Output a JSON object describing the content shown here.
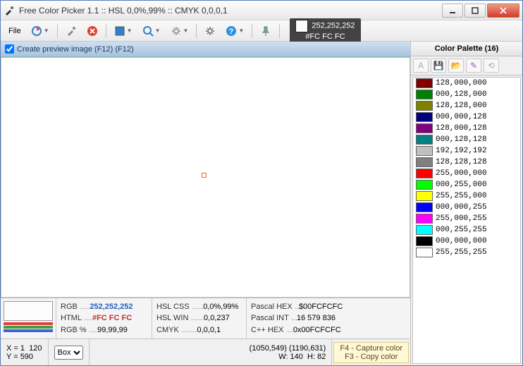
{
  "title": "Free Color Picker 1.1  ::  HSL 0,0%,99%  ::  CMYK 0,0,0,1",
  "file_menu": "File",
  "color_display": {
    "rgb": "252,252,252",
    "hex": "#FC  FC  FC"
  },
  "preview_label": "Create preview image (F12) (F12)",
  "info": {
    "rgb": {
      "label": "RGB",
      "value": "252,252,252"
    },
    "html": {
      "label": "HTML",
      "value": "#FC  FC  FC"
    },
    "rgbp": {
      "label": "RGB %",
      "value": "99,99,99"
    },
    "hslcss": {
      "label": "HSL CSS",
      "value": "0,0%,99%"
    },
    "hslwin": {
      "label": "HSL WIN",
      "value": "0,0,237"
    },
    "cmyk": {
      "label": "CMYK",
      "value": "0,0,0,1"
    },
    "pascalhex": {
      "label": "Pascal HEX",
      "value": "$00FCFCFC"
    },
    "pascalint": {
      "label": "Pascal INT",
      "value": "16 579 836"
    },
    "cpphex": {
      "label": "C++ HEX",
      "value": "0x00FCFCFC"
    }
  },
  "status": {
    "x_label": "X =",
    "x1": "1",
    "x2": "120",
    "y_label": "Y =",
    "y": "590",
    "select_value": "Box",
    "coords1": "(1050,549)",
    "coords2": "(1190,631)",
    "w_label": "W:",
    "w": "140",
    "h_label": "H:",
    "h": "82",
    "hint1": "F4 - Capture color",
    "hint2": "F3 - Copy color"
  },
  "palette": {
    "title": "Color Palette (16)",
    "items": [
      {
        "color": "#800000",
        "text": "128,000,000"
      },
      {
        "color": "#008000",
        "text": "000,128,000"
      },
      {
        "color": "#808000",
        "text": "128,128,000"
      },
      {
        "color": "#000080",
        "text": "000,000,128"
      },
      {
        "color": "#800080",
        "text": "128,000,128"
      },
      {
        "color": "#008080",
        "text": "000,128,128"
      },
      {
        "color": "#c0c0c0",
        "text": "192,192,192"
      },
      {
        "color": "#808080",
        "text": "128,128,128"
      },
      {
        "color": "#ff0000",
        "text": "255,000,000"
      },
      {
        "color": "#00ff00",
        "text": "000,255,000"
      },
      {
        "color": "#ffff00",
        "text": "255,255,000"
      },
      {
        "color": "#0000ff",
        "text": "000,000,255"
      },
      {
        "color": "#ff00ff",
        "text": "255,000,255"
      },
      {
        "color": "#00ffff",
        "text": "000,255,255"
      },
      {
        "color": "#000000",
        "text": "000,000,000"
      },
      {
        "color": "#ffffff",
        "text": "255,255,255"
      }
    ]
  }
}
